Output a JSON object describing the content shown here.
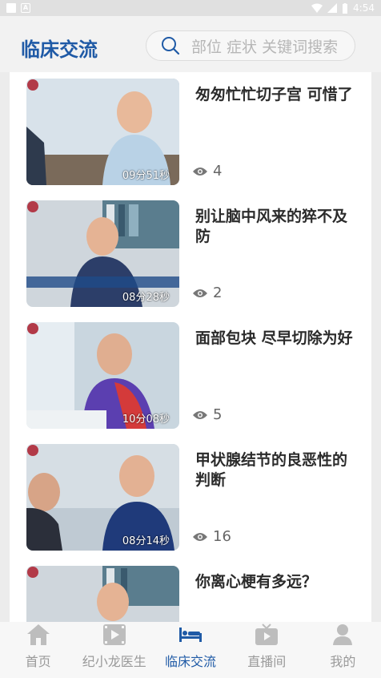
{
  "status": {
    "time": "4:54"
  },
  "header": {
    "title": "临床交流",
    "search_placeholder": "部位 症状 关键词搜索"
  },
  "items": [
    {
      "title": "匆匆忙忙切子宫 可惜了",
      "duration": "09分51秒",
      "views": "4"
    },
    {
      "title": "别让脑中风来的猝不及防",
      "duration": "08分28秒",
      "views": "2"
    },
    {
      "title": "面部包块 尽早切除为好",
      "duration": "10分08秒",
      "views": "5"
    },
    {
      "title": "甲状腺结节的良恶性的判断",
      "duration": "08分14秒",
      "views": "16"
    },
    {
      "title": "你离心梗有多远？",
      "duration": "",
      "views": ""
    }
  ],
  "tabs": [
    {
      "label": "首页",
      "icon": "home-icon"
    },
    {
      "label": "纪小龙医生",
      "icon": "video-icon"
    },
    {
      "label": "临床交流",
      "icon": "bed-icon",
      "active": true
    },
    {
      "label": "直播间",
      "icon": "tv-icon"
    },
    {
      "label": "我的",
      "icon": "person-icon"
    }
  ],
  "colors": {
    "accent": "#1f5aa6",
    "inactive": "#9a9a9a"
  }
}
